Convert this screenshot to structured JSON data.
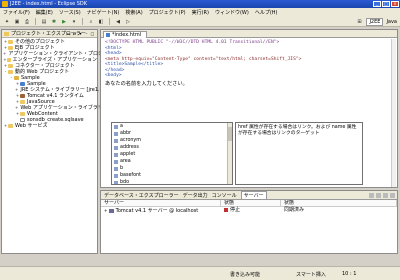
{
  "window": {
    "title": "J2EE - index.html - Eclipse SDK",
    "controls": [
      "_",
      "□",
      "×"
    ]
  },
  "menu": [
    "ファイル(F)",
    "編集(E)",
    "ソース(S)",
    "ナビゲート(N)",
    "検索(A)",
    "プロジェクト(P)",
    "実行(R)",
    "ウィンドウ(W)",
    "ヘルプ(H)"
  ],
  "perspective": {
    "active": "J2EE",
    "other": "Java"
  },
  "left_panel": {
    "title": "プロジェクト・エクスプローラー",
    "tree": [
      {
        "label": "その他のプロジェクト",
        "indent": 0,
        "twist": "+",
        "icon": "folder"
      },
      {
        "label": "EJB プロジェクト",
        "indent": 0,
        "twist": "+",
        "icon": "folder"
      },
      {
        "label": "アプリケーション・クライアント・プロジェクト",
        "indent": 0,
        "twist": "+",
        "icon": "folder"
      },
      {
        "label": "エンタープライズ・アプリケーション",
        "indent": 0,
        "twist": "+",
        "icon": "folder"
      },
      {
        "label": "コネクター・プロジェクト",
        "indent": 0,
        "twist": "+",
        "icon": "folder"
      },
      {
        "label": "動的 Web プロジェクト",
        "indent": 0,
        "twist": "-",
        "icon": "folder"
      },
      {
        "label": "Sample",
        "indent": 1,
        "twist": "-",
        "icon": "proj"
      },
      {
        "label": "Sample",
        "indent": 2,
        "twist": "+",
        "icon": "web"
      },
      {
        "label": "JRE システム・ライブラリー [jre1.6.0_...",
        "indent": 2,
        "twist": "+",
        "icon": "jar"
      },
      {
        "label": "Tomcat v4.1 ランタイム",
        "indent": 2,
        "twist": "+",
        "icon": "jar"
      },
      {
        "label": "JavaSource",
        "indent": 2,
        "twist": "+",
        "icon": "folder"
      },
      {
        "label": "Web アプリケーション・ライブラリー [Sa...",
        "indent": 2,
        "twist": "+",
        "icon": "jar"
      },
      {
        "label": "WebContent",
        "indent": 2,
        "twist": "+",
        "icon": "folder"
      },
      {
        "label": "sonsdb_create.sqlsave",
        "indent": 2,
        "twist": "",
        "icon": "file"
      },
      {
        "label": "Web サービス",
        "indent": 0,
        "twist": "+",
        "icon": "folder"
      }
    ]
  },
  "editor": {
    "tab": "*index.html",
    "code": [
      {
        "text": "<!DOCTYPE HTML PUBLIC \"-//W3C//DTD HTML 4.01 Transitional//EN\">",
        "cls": "c1"
      },
      {
        "text": "<html>",
        "cls": "c2"
      },
      {
        "text": "<head>",
        "cls": "c2"
      },
      {
        "text": "<meta http-equiv=\"Content-Type\" content=\"text/html; charset=Shift_JIS\">",
        "cls": "c3"
      },
      {
        "text": "<title>Sample</title>",
        "cls": "c2"
      },
      {
        "text": "</head>",
        "cls": "c2"
      },
      {
        "text": "<body>",
        "cls": "c2"
      }
    ],
    "jp_line": "あなたの名前を入力してください。",
    "autocomplete": [
      "a",
      "abbr",
      "acronym",
      "address",
      "applet",
      "area",
      "b",
      "basefont",
      "bdo"
    ],
    "info": "href 属性が存在する場合はリンク。および name 属性が存在する場合はリンクのターゲット"
  },
  "bottom_panel": {
    "tabs": [
      "データベース・エクスプローラー",
      "データ出力",
      "コンソール",
      "サーバー"
    ],
    "active_tab": "サーバー",
    "columns": [
      "サーバー",
      "状態",
      "状態"
    ],
    "row": {
      "server": "Tomcat v4.1 サーバー @ localhost",
      "state": "停止",
      "status": "同期済み"
    }
  },
  "statusbar": {
    "writable": "書き込み可能",
    "insert": "スマート挿入",
    "position": "10 : 1"
  }
}
